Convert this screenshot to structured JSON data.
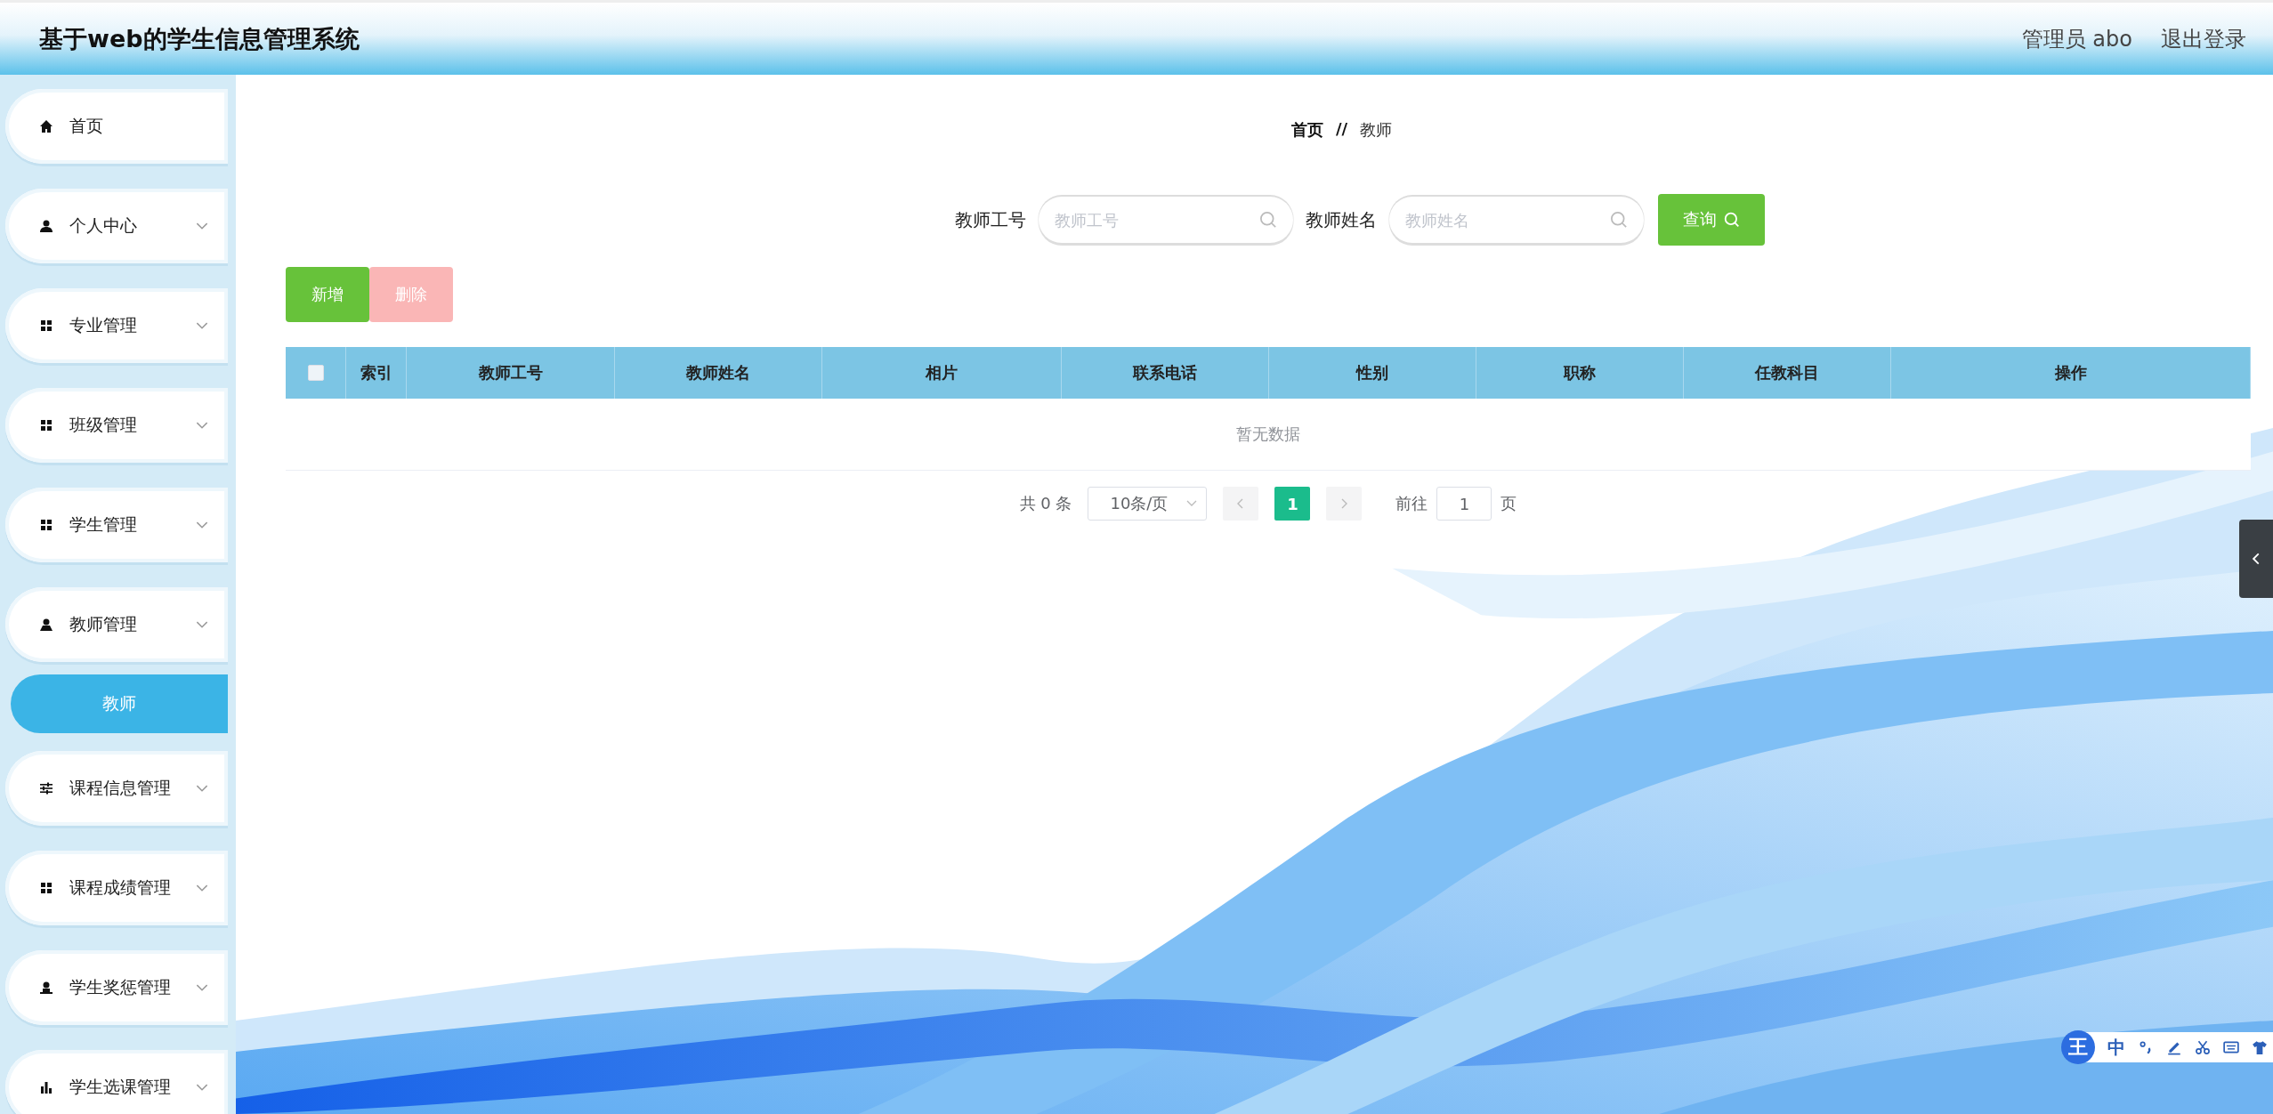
{
  "header": {
    "title": "基于web的学生信息管理系统",
    "user": "管理员 abo",
    "logout": "退出登录"
  },
  "sidebar": {
    "items": [
      {
        "label": "首页",
        "kind": "link"
      },
      {
        "label": "个人中心",
        "kind": "submenu"
      },
      {
        "label": "专业管理",
        "kind": "submenu"
      },
      {
        "label": "班级管理",
        "kind": "submenu"
      },
      {
        "label": "学生管理",
        "kind": "submenu"
      },
      {
        "label": "教师管理",
        "kind": "submenu",
        "children": [
          {
            "label": "教师",
            "selected": true
          }
        ]
      },
      {
        "label": "课程信息管理",
        "kind": "submenu"
      },
      {
        "label": "课程成绩管理",
        "kind": "submenu"
      },
      {
        "label": "学生奖惩管理",
        "kind": "submenu"
      },
      {
        "label": "学生选课管理",
        "kind": "submenu"
      }
    ]
  },
  "breadcrumb": {
    "items": [
      "首页",
      "教师"
    ],
    "separator": "//"
  },
  "search": {
    "fields": [
      {
        "label": "教师工号",
        "placeholder": "教师工号"
      },
      {
        "label": "教师姓名",
        "placeholder": "教师姓名"
      }
    ],
    "button": "查询"
  },
  "actions": [
    {
      "label": "新增",
      "kind": "primary",
      "disabled": false
    },
    {
      "label": "删除",
      "kind": "danger",
      "disabled": true
    }
  ],
  "table": {
    "select_all_checked": false,
    "columns": [
      "索引",
      "教师工号",
      "教师姓名",
      "相片",
      "联系电话",
      "性别",
      "职称",
      "任教科目",
      "操作"
    ],
    "empty_text": "暂无数据"
  },
  "pagination": {
    "total": "共 0 条",
    "page_size": "10条/页",
    "pages": [
      {
        "label": "1",
        "selected": true
      }
    ],
    "jump_label": "前往",
    "jump_value": "1",
    "jump_suffix": "页"
  },
  "ime_toolbar": {
    "logo": "王",
    "mode": "中"
  }
}
